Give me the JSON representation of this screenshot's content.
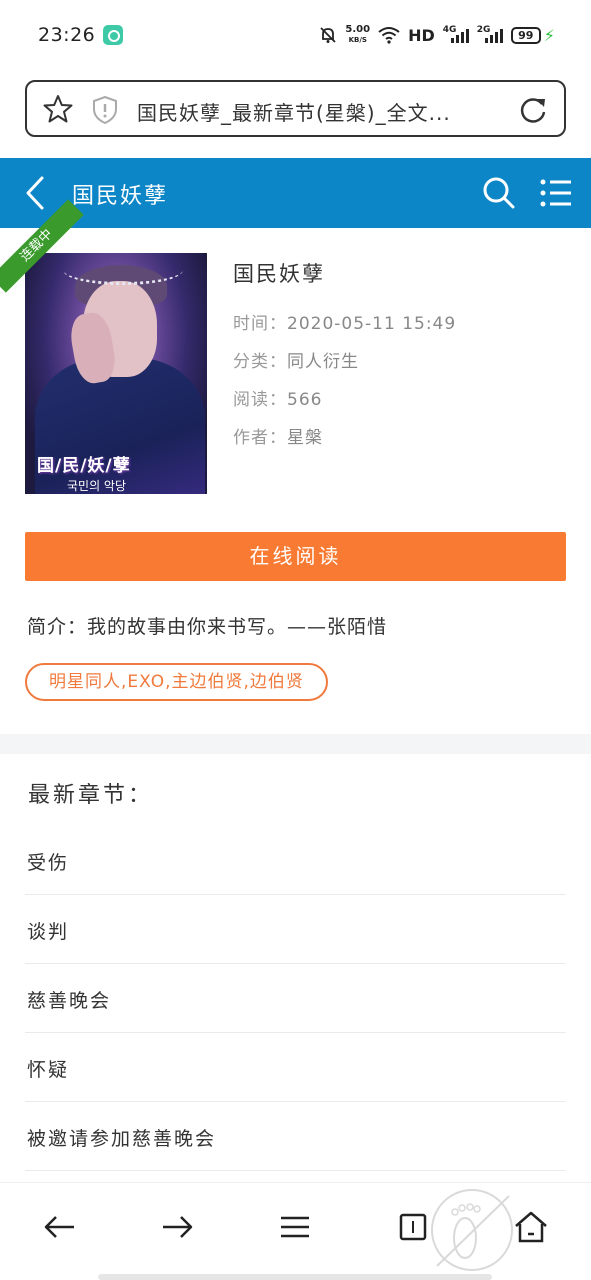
{
  "status_bar": {
    "time": "23:26",
    "net_speed": "5.00",
    "net_speed_unit": "KB/S",
    "hd": "HD",
    "net1": "4G",
    "net2": "2G",
    "battery": "99"
  },
  "address_bar": {
    "url_text": "国民妖孽_最新章节(星槃)_全文..."
  },
  "header": {
    "title": "国民妖孽"
  },
  "book": {
    "status_ribbon": "连载中",
    "cover_title": "国/民/妖/孽",
    "cover_subtitle": "국민의 악당",
    "title": "国民妖孽",
    "time_label": "时间：",
    "time_value": "2020-05-11 15:49",
    "category_label": "分类：",
    "category_value": "同人衍生",
    "reads_label": "阅读：",
    "reads_value": "566",
    "author_label": "作者：",
    "author_value": "星槃",
    "read_button": "在线阅读",
    "summary": "简介：我的故事由你来书写。——张陌惜",
    "tags": "明星同人,EXO,主边伯贤,边伯贤"
  },
  "latest": {
    "heading": "最新章节：",
    "chapters": [
      "受伤",
      "谈判",
      "慈善晚会",
      "怀疑",
      "被邀请参加慈善晚会"
    ]
  },
  "colors": {
    "header_blue": "#0d86c8",
    "accent_orange": "#f97a32",
    "ribbon_green": "#3a9a2c"
  },
  "icons": {
    "address_left": [
      "star-icon",
      "shield-icon"
    ],
    "address_right": "reload-icon",
    "header": [
      "back-chevron-icon",
      "search-icon",
      "menu-list-icon"
    ],
    "bottom_nav": [
      "back-arrow-icon",
      "forward-arrow-icon",
      "menu-icon",
      "tabs-icon",
      "home-icon"
    ]
  }
}
